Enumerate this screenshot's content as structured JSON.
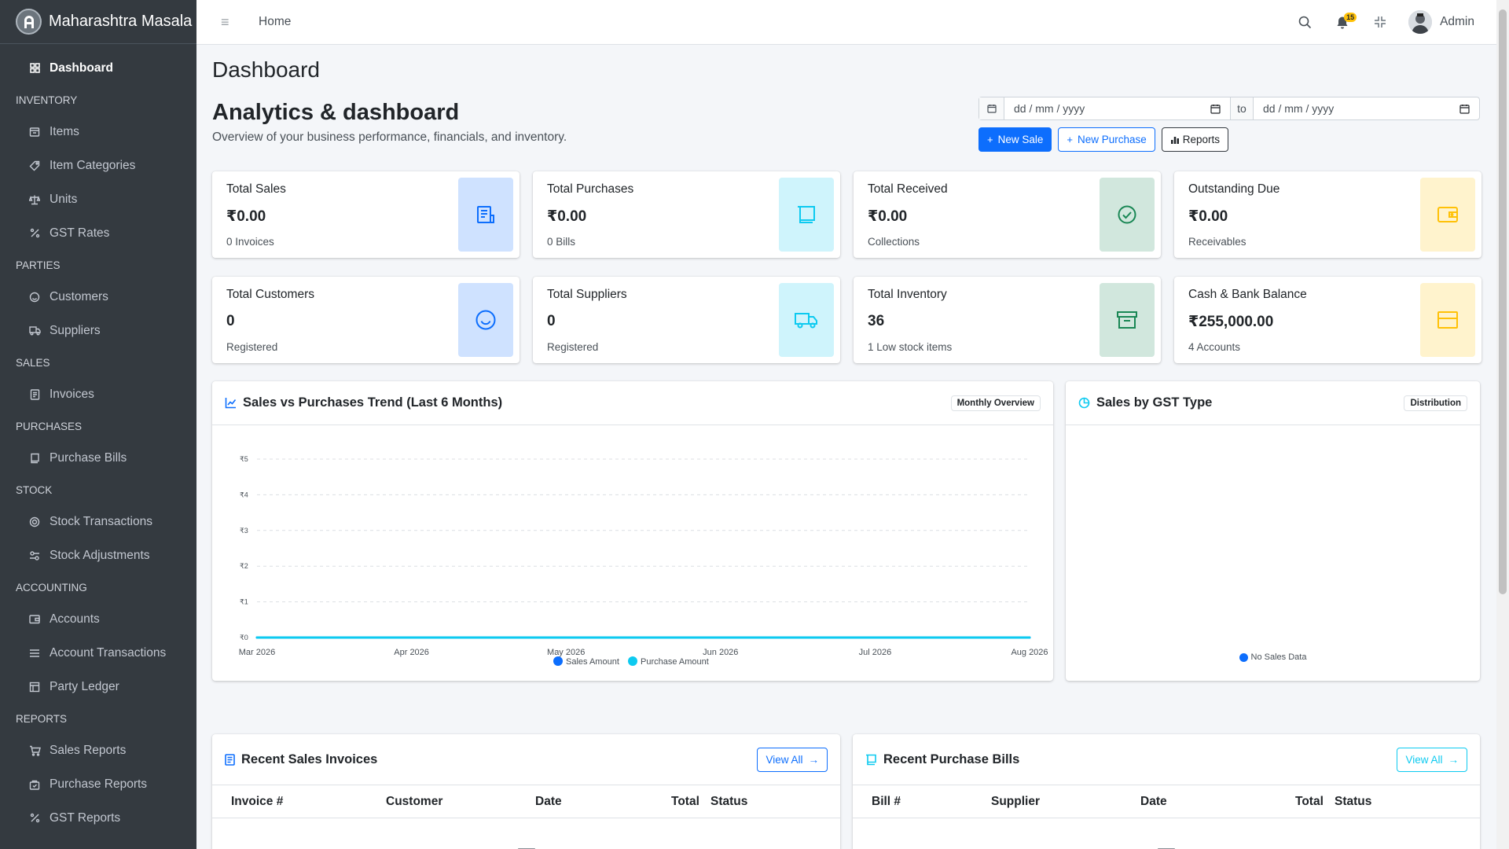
{
  "brand": {
    "name": "Maharashtra Masala"
  },
  "sidebar": {
    "dashboard": "Dashboard",
    "inventory_header": "INVENTORY",
    "items": "Items",
    "item_categories": "Item Categories",
    "units": "Units",
    "gst_rates": "GST Rates",
    "parties_header": "PARTIES",
    "customers": "Customers",
    "suppliers": "Suppliers",
    "sales_header": "SALES",
    "invoices": "Invoices",
    "purchases_header": "PURCHASES",
    "purchase_bills": "Purchase Bills",
    "stock_header": "STOCK",
    "stock_transactions": "Stock Transactions",
    "stock_adjustments": "Stock Adjustments",
    "accounting_header": "ACCOUNTING",
    "accounts": "Accounts",
    "account_transactions": "Account Transactions",
    "party_ledger": "Party Ledger",
    "reports_header": "REPORTS",
    "sales_reports": "Sales Reports",
    "purchase_reports": "Purchase Reports",
    "gst_reports": "GST Reports"
  },
  "topbar": {
    "home": "Home",
    "notification_count": "15",
    "user": "Admin"
  },
  "page": {
    "title": "Dashboard",
    "section_title": "Analytics & dashboard",
    "section_subtitle": "Overview of your business performance, financials, and inventory."
  },
  "filters": {
    "from_placeholder": "dd / mm / yyyy",
    "to_label": "to",
    "to_placeholder": "dd / mm / yyyy"
  },
  "actions": {
    "new_sale": "New Sale",
    "new_purchase": "New Purchase",
    "reports": "Reports"
  },
  "stats": {
    "total_sales": {
      "label": "Total Sales",
      "value": "₹0.00",
      "note": "0 Invoices"
    },
    "total_purchases": {
      "label": "Total Purchases",
      "value": "₹0.00",
      "note": "0 Bills"
    },
    "total_received": {
      "label": "Total Received",
      "value": "₹0.00",
      "note": "Collections"
    },
    "outstanding_due": {
      "label": "Outstanding Due",
      "value": "₹0.00",
      "note": "Receivables"
    },
    "total_customers": {
      "label": "Total Customers",
      "value": "0",
      "note": "Registered"
    },
    "total_suppliers": {
      "label": "Total Suppliers",
      "value": "0",
      "note": "Registered"
    },
    "total_inventory": {
      "label": "Total Inventory",
      "value": "36",
      "note": "1 Low stock items"
    },
    "cash_bank": {
      "label": "Cash & Bank Balance",
      "value": "₹255,000.00",
      "note": "4 Accounts"
    }
  },
  "trend_panel": {
    "title": "Sales vs Purchases Trend (Last 6 Months)",
    "badge": "Monthly Overview"
  },
  "gst_panel": {
    "title": "Sales by GST Type",
    "badge": "Distribution",
    "legend": "No Sales Data"
  },
  "chart_data": [
    {
      "type": "line",
      "x": [
        "Mar 2026",
        "Apr 2026",
        "May 2026",
        "Jun 2026",
        "Jul 2026",
        "Aug 2026"
      ],
      "series": [
        {
          "name": "Sales Amount",
          "values": [
            0,
            0,
            0,
            0,
            0,
            0
          ],
          "color": "#0d6efd"
        },
        {
          "name": "Purchase Amount",
          "values": [
            0,
            0,
            0,
            0,
            0,
            0
          ],
          "color": "#0dcaf0"
        }
      ],
      "y_ticks": [
        "₹0",
        "₹1",
        "₹2",
        "₹3",
        "₹4",
        "₹5"
      ],
      "ylim": [
        0,
        5
      ],
      "grid": true,
      "legend": "bottom"
    },
    {
      "type": "pie",
      "categories": [
        "No Sales Data"
      ],
      "values": [],
      "legend": "bottom"
    }
  ],
  "recent_sales": {
    "title": "Recent Sales Invoices",
    "view_all": "View All",
    "columns": [
      "Invoice #",
      "Customer",
      "Date",
      "Total",
      "Status"
    ]
  },
  "recent_purchases": {
    "title": "Recent Purchase Bills",
    "view_all": "View All",
    "columns": [
      "Bill #",
      "Supplier",
      "Date",
      "Total",
      "Status"
    ]
  },
  "colors": {
    "primary": "#0d6efd",
    "info": "#0dcaf0",
    "success": "#198754",
    "warning": "#ffc107",
    "sidebar": "#343a40"
  }
}
